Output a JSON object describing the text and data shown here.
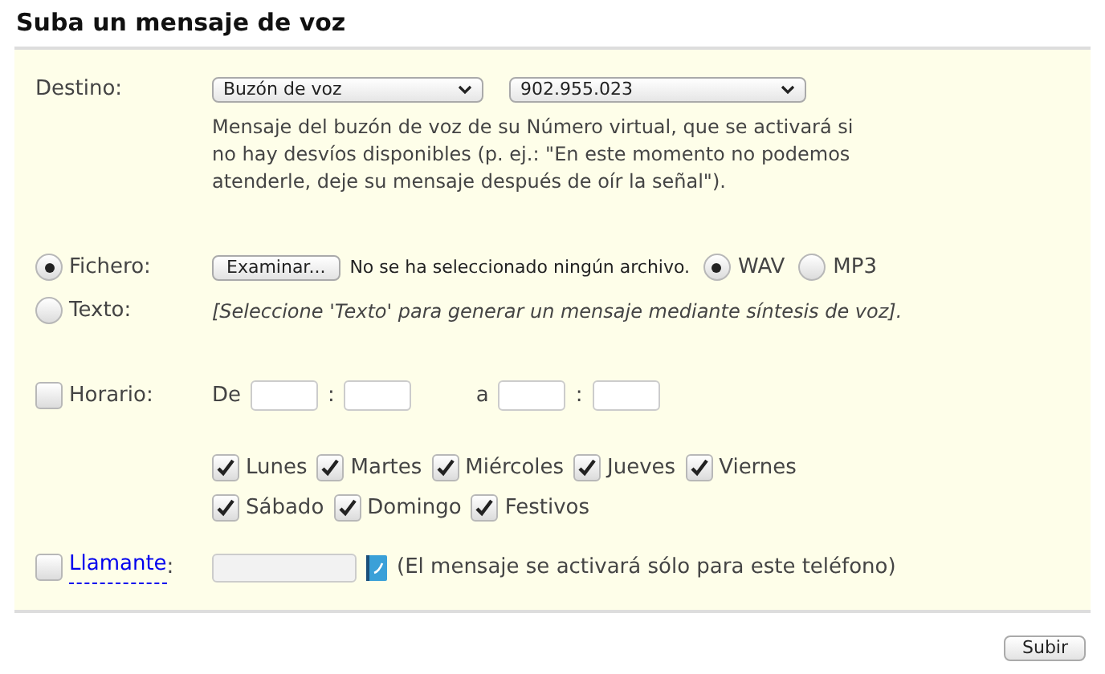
{
  "title": "Suba un mensaje de voz",
  "destino": {
    "label": "Destino:",
    "selects": [
      {
        "value": "Buzón de voz"
      },
      {
        "value": "902.955.023"
      }
    ],
    "description": "Mensaje del buzón de voz de su Número virtual, que se activará si no hay desvíos disponibles (p. ej.: \"En este momento no podemos atenderle, deje su mensaje después de oír la señal\")."
  },
  "source": [
    {
      "kind": "file",
      "label": "Fichero:",
      "selected": true,
      "button": "Examinar...",
      "file_status": "No se ha seleccionado ningún archivo.",
      "formats": [
        {
          "label": "WAV",
          "selected": true
        },
        {
          "label": "MP3",
          "selected": false
        }
      ]
    },
    {
      "kind": "text",
      "label": "Texto:",
      "selected": false,
      "hint": "[Seleccione 'Texto' para generar un mensaje mediante síntesis de voz]."
    }
  ],
  "horario": {
    "label": "Horario:",
    "checked": false,
    "from_label": "De",
    "to_label": "a",
    "separators": [
      ":",
      ":"
    ],
    "days": [
      [
        {
          "label": "Lunes",
          "checked": true
        },
        {
          "label": "Martes",
          "checked": true
        },
        {
          "label": "Miércoles",
          "checked": true
        },
        {
          "label": "Jueves",
          "checked": true
        },
        {
          "label": "Viernes",
          "checked": true
        }
      ],
      [
        {
          "label": "Sábado",
          "checked": true
        },
        {
          "label": "Domingo",
          "checked": true
        },
        {
          "label": "Festivos",
          "checked": true
        }
      ]
    ]
  },
  "llamante": {
    "label": "Llamante",
    "suffix": ":",
    "checked": false,
    "note": "(El mensaje se activará sólo para este teléfono)"
  },
  "submit": "Subir"
}
